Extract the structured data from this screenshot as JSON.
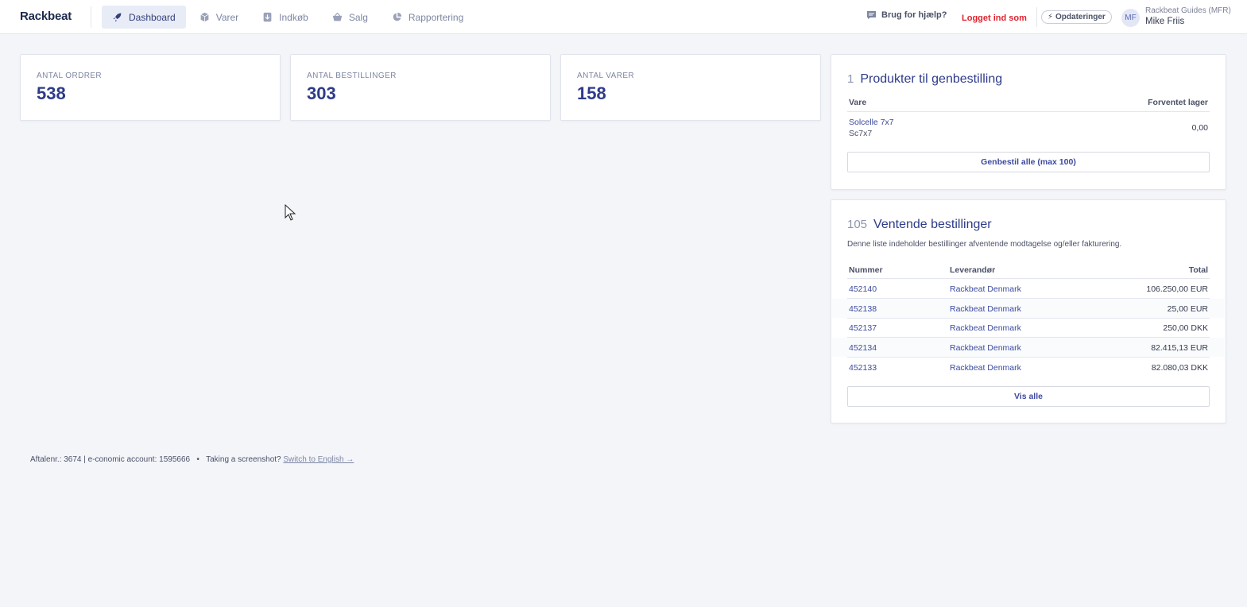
{
  "app": {
    "logo": "Rackbeat"
  },
  "nav": {
    "items": [
      {
        "label": "Dashboard",
        "icon": "rocket-icon",
        "active": true
      },
      {
        "label": "Varer",
        "icon": "box-icon"
      },
      {
        "label": "Indkøb",
        "icon": "purchase-icon"
      },
      {
        "label": "Salg",
        "icon": "basket-icon"
      },
      {
        "label": "Rapportering",
        "icon": "pie-chart-icon"
      }
    ],
    "help": "Brug for hjælp?",
    "logged_in_as": "Logget ind som",
    "updates": "Opdateringer",
    "user": {
      "initials": "MF",
      "company": "Rackbeat Guides (MFR)",
      "name": "Mike Friis"
    }
  },
  "stats": [
    {
      "label": "ANTAL ORDRER",
      "value": "538"
    },
    {
      "label": "ANTAL BESTILLINGER",
      "value": "303"
    },
    {
      "label": "ANTAL VARER",
      "value": "158"
    }
  ],
  "reorder": {
    "count": "1",
    "title": "Produkter til genbestilling",
    "columns": [
      "Vare",
      "Forventet lager"
    ],
    "rows": [
      {
        "name": "Solcelle 7x7",
        "sku": "Sc7x7",
        "stock": "0,00"
      }
    ],
    "button": "Genbestil alle (max 100)"
  },
  "pending": {
    "count": "105",
    "title": "Ventende bestillinger",
    "description": "Denne liste indeholder bestillinger afventende modtagelse og/eller fakturering.",
    "columns": [
      "Nummer",
      "Leverandør",
      "Total"
    ],
    "rows": [
      {
        "number": "452140",
        "supplier": "Rackbeat Denmark",
        "total": "106.250,00 EUR"
      },
      {
        "number": "452138",
        "supplier": "Rackbeat Denmark",
        "total": "25,00 EUR"
      },
      {
        "number": "452137",
        "supplier": "Rackbeat Denmark",
        "total": "250,00 DKK"
      },
      {
        "number": "452134",
        "supplier": "Rackbeat Denmark",
        "total": "82.415,13 EUR"
      },
      {
        "number": "452133",
        "supplier": "Rackbeat Denmark",
        "total": "82.080,03 DKK"
      }
    ],
    "button": "Vis alle"
  },
  "footer": {
    "info": "Aftalenr.: 3674 | e-conomic account: 1595666",
    "separator": "•",
    "prompt": "Taking a screenshot?",
    "link": "Switch to English →"
  },
  "colors": {
    "accent": "#2e3b8a",
    "danger": "#e0232e",
    "background": "#f3f5f9"
  }
}
